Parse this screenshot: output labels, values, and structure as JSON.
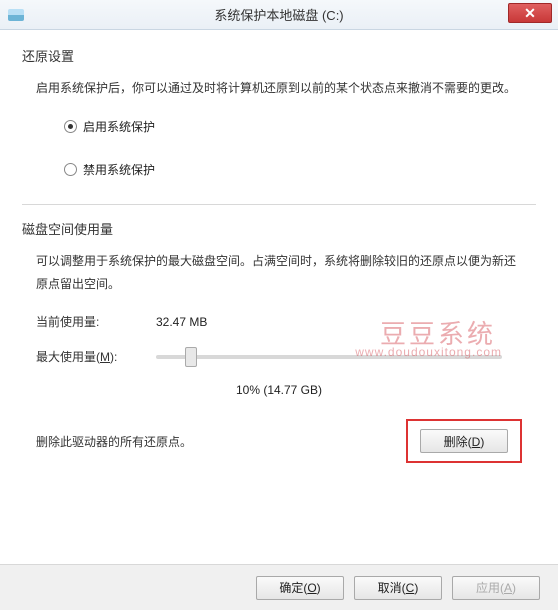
{
  "title": "系统保护本地磁盘 (C:)",
  "restore": {
    "title": "还原设置",
    "desc": "启用系统保护后，你可以通过及时将计算机还原到以前的某个状态点来撤消不需要的更改。",
    "optEnable": "启用系统保护",
    "optDisable": "禁用系统保护"
  },
  "disk": {
    "title": "磁盘空间使用量",
    "desc": "可以调整用于系统保护的最大磁盘空间。占满空间时，系统将删除较旧的还原点以便为新还原点留出空间。",
    "currentLabel": "当前使用量:",
    "currentValue": "32.47 MB",
    "maxLabelPrefix": "最大使用量(",
    "maxLabelKey": "M",
    "maxLabelSuffix": "):",
    "sliderValue": "10% (14.77 GB)",
    "deleteText": "删除此驱动器的所有还原点。",
    "deleteBtnPrefix": "删除(",
    "deleteBtnKey": "D",
    "deleteBtnSuffix": ")"
  },
  "footer": {
    "okPrefix": "确定(",
    "okKey": "O",
    "okSuffix": ")",
    "cancelPrefix": "取消(",
    "cancelKey": "C",
    "cancelSuffix": ")",
    "applyPrefix": "应用(",
    "applyKey": "A",
    "applySuffix": ")"
  },
  "watermark": {
    "line1": "豆豆系统",
    "line2": "www.doudouxitong.com"
  }
}
